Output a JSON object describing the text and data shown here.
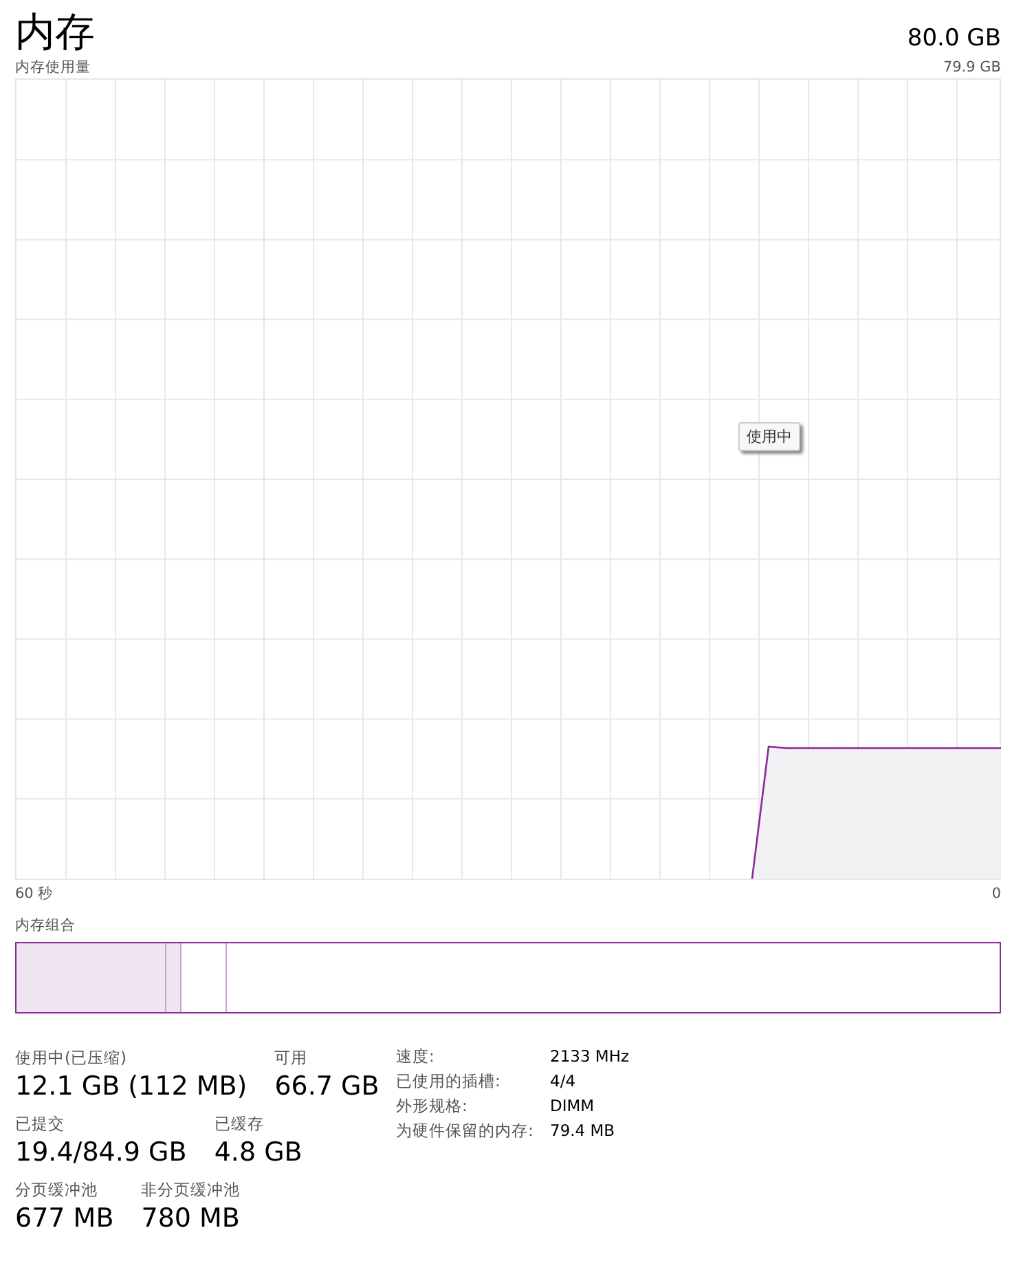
{
  "header": {
    "title": "内存",
    "total": "80.0 GB"
  },
  "chart": {
    "label": "内存使用量",
    "max_label": "79.9 GB",
    "left_label": "60 秒",
    "right_label": "0",
    "tooltip": "使用中"
  },
  "composition": {
    "label": "内存组合",
    "segments": [
      {
        "kind": "in_use",
        "level": 0.152
      },
      {
        "kind": "modified"
      },
      {
        "kind": "standby"
      },
      {
        "kind": "free"
      }
    ]
  },
  "stats": [
    [
      {
        "label": "使用中(已压缩)",
        "value": "12.1 GB (112 MB)"
      },
      {
        "label": "可用",
        "value": "66.7 GB"
      }
    ],
    [
      {
        "label": "已提交",
        "value": "19.4/84.9 GB"
      },
      {
        "label": "已缓存",
        "value": "4.8 GB"
      }
    ],
    [
      {
        "label": "分页缓冲池",
        "value": "677 MB"
      },
      {
        "label": "非分页缓冲池",
        "value": "780 MB"
      }
    ]
  ],
  "details": [
    {
      "label": "速度:",
      "value": "2133 MHz"
    },
    {
      "label": "已使用的插槽:",
      "value": "4/4"
    },
    {
      "label": "外形规格:",
      "value": "DIMM"
    },
    {
      "label": "为硬件保留的内存:",
      "value": "79.4 MB"
    }
  ]
}
